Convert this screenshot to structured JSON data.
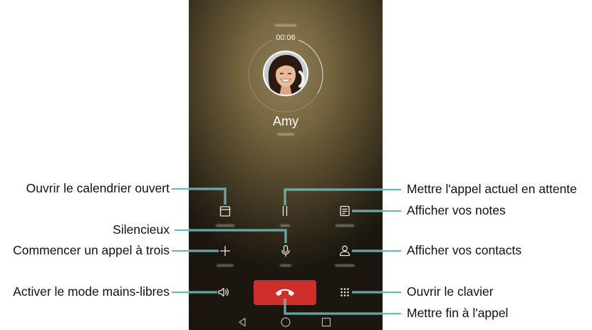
{
  "call": {
    "timer": "00:06",
    "contact_name": "Amy",
    "avatar": "contact-photo",
    "buttons": {
      "calendar": {
        "icon": "calendar-icon"
      },
      "hold": {
        "icon": "pause-icon"
      },
      "notepad": {
        "icon": "notepad-icon"
      },
      "add_call": {
        "icon": "plus-icon"
      },
      "mute": {
        "icon": "microphone-icon"
      },
      "contacts": {
        "icon": "contact-person-icon"
      },
      "speaker": {
        "icon": "speaker-icon"
      },
      "end_call": {
        "icon": "hang-up-icon"
      },
      "dialpad": {
        "icon": "dialpad-icon"
      }
    },
    "nav": {
      "back": "back-triangle-icon",
      "home": "home-circle-icon",
      "recents": "recents-square-icon"
    }
  },
  "callouts": {
    "calendar": "Ouvrir le calendrier ouvert",
    "hold": "Mettre l'appel actuel en attente",
    "notepad": "Afficher vos notes",
    "mute": "Silencieux",
    "add_call": "Commencer un appel à trois",
    "contacts": "Afficher vos contacts",
    "speaker": "Activer le mode mains-libres",
    "dialpad": "Ouvrir le clavier",
    "end_call": "Mettre fin à l'appel"
  },
  "colors": {
    "callout_line": "#3fb5b7",
    "end_call_button": "#cf2e2b",
    "label_text": "#111111",
    "screen_icon": "#ece8dc"
  }
}
